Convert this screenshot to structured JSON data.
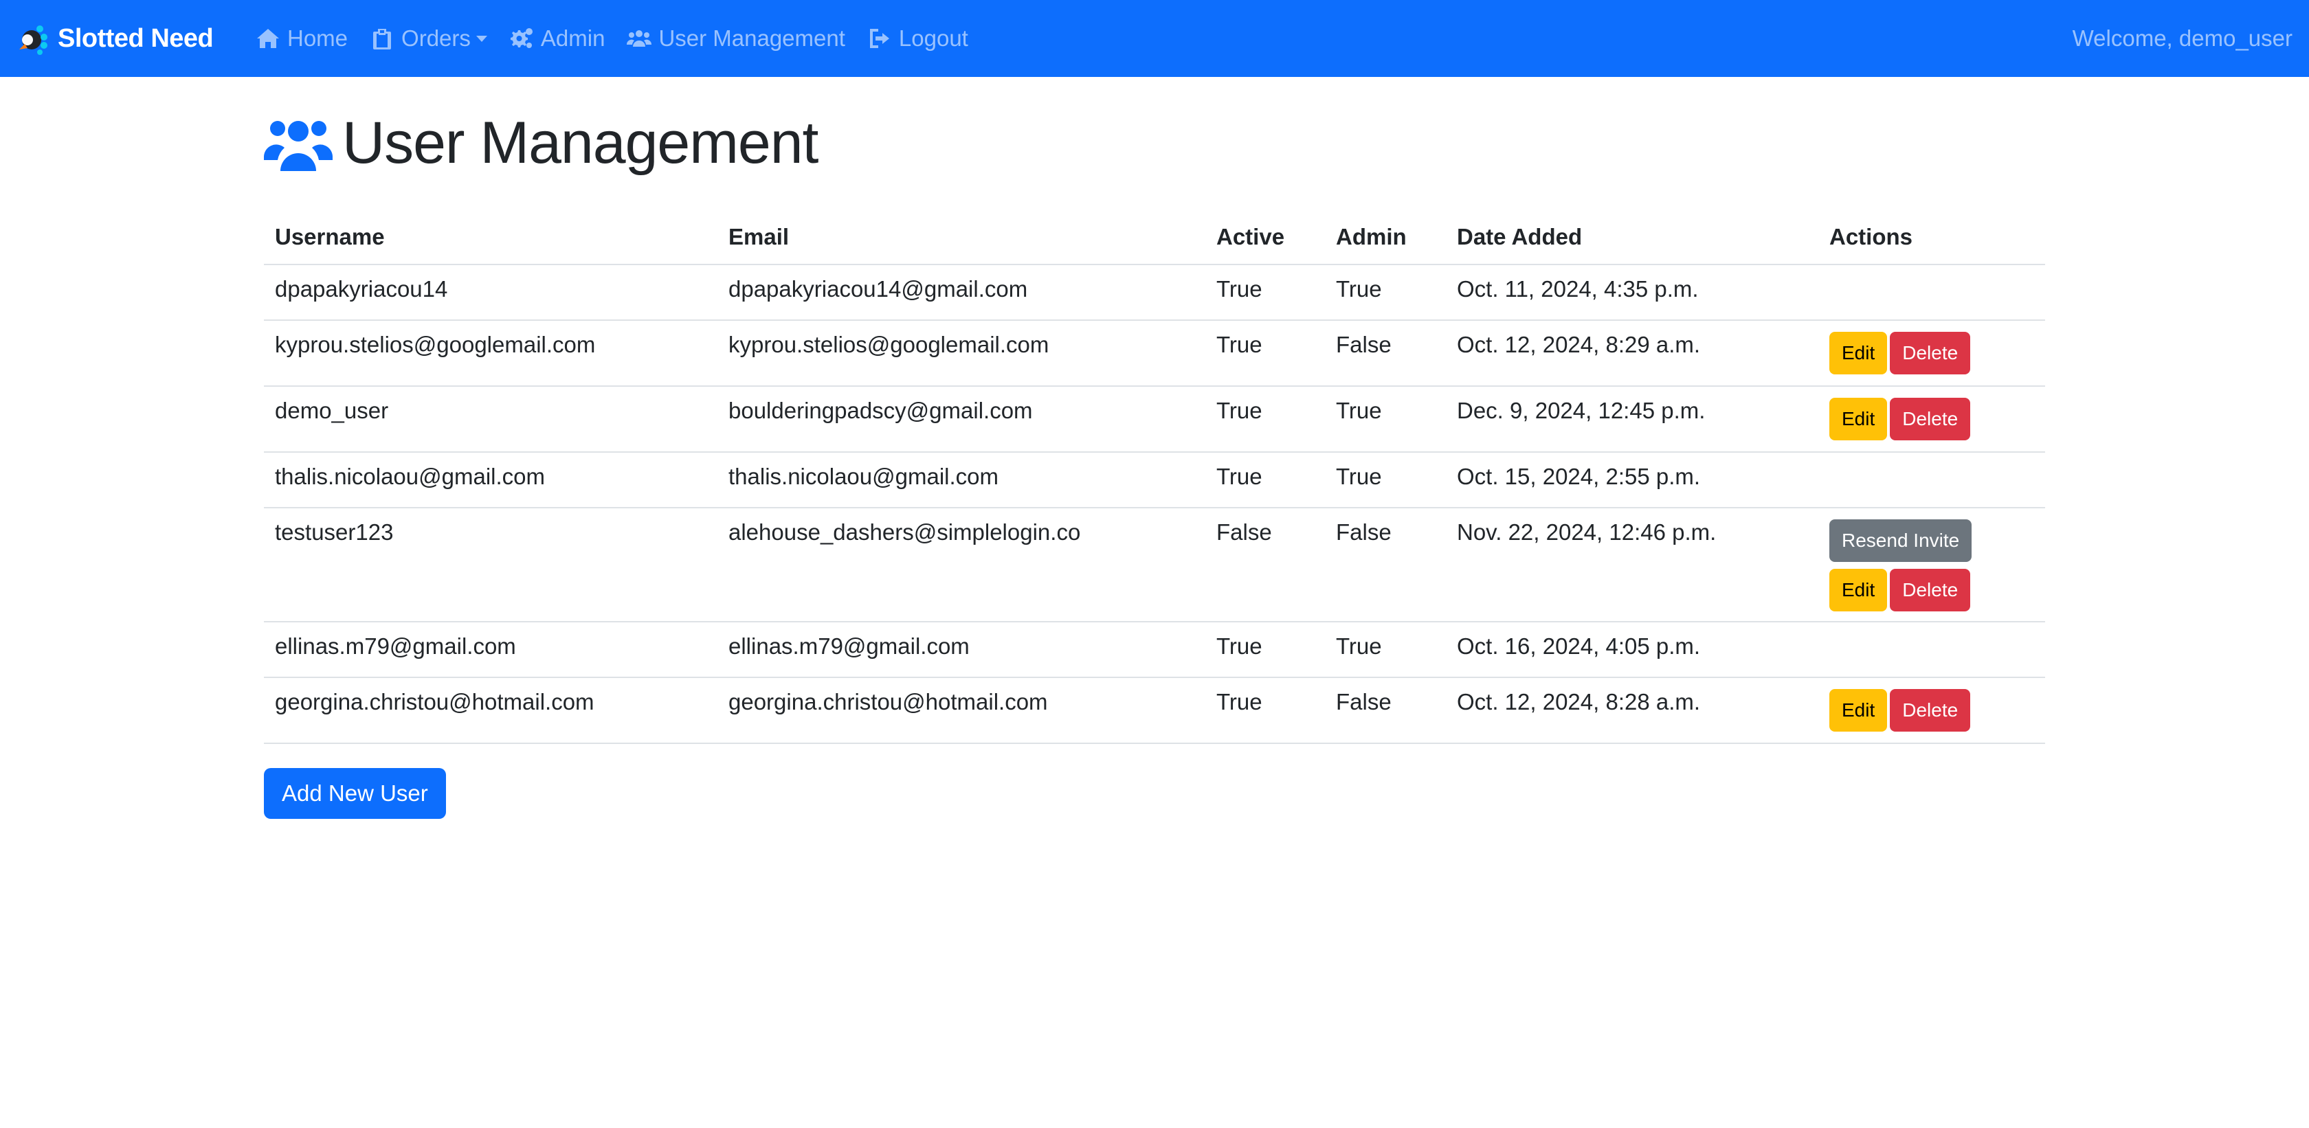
{
  "navbar": {
    "brand": "Slotted Need",
    "items": [
      {
        "label": "Home",
        "icon": "home-icon"
      },
      {
        "label": "Orders",
        "icon": "clipboard-icon",
        "dropdown": true
      },
      {
        "label": "Admin",
        "icon": "gears-icon"
      },
      {
        "label": "User Management",
        "icon": "users-icon"
      },
      {
        "label": "Logout",
        "icon": "logout-icon"
      }
    ],
    "welcome": "Welcome, demo_user"
  },
  "page": {
    "title": "User Management",
    "title_icon": "users-icon"
  },
  "table": {
    "headers": [
      "Username",
      "Email",
      "Active",
      "Admin",
      "Date Added",
      "Actions"
    ],
    "rows": [
      {
        "username": "dpapakyriacou14",
        "email": "dpapakyriacou14@gmail.com",
        "active": "True",
        "admin": "True",
        "date_added": "Oct. 11, 2024, 4:35 p.m.",
        "actions": []
      },
      {
        "username": "kyprou.stelios@googlemail.com",
        "email": "kyprou.stelios@googlemail.com",
        "active": "True",
        "admin": "False",
        "date_added": "Oct. 12, 2024, 8:29 a.m.",
        "actions": [
          "Edit",
          "Delete"
        ]
      },
      {
        "username": "demo_user",
        "email": "boulderingpadscy@gmail.com",
        "active": "True",
        "admin": "True",
        "date_added": "Dec. 9, 2024, 12:45 p.m.",
        "actions": [
          "Edit",
          "Delete"
        ]
      },
      {
        "username": "thalis.nicolaou@gmail.com",
        "email": "thalis.nicolaou@gmail.com",
        "active": "True",
        "admin": "True",
        "date_added": "Oct. 15, 2024, 2:55 p.m.",
        "actions": []
      },
      {
        "username": "testuser123",
        "email": "alehouse_dashers@simplelogin.co",
        "active": "False",
        "admin": "False",
        "date_added": "Nov. 22, 2024, 12:46 p.m.",
        "actions": [
          "Resend Invite",
          "Edit",
          "Delete"
        ]
      },
      {
        "username": "ellinas.m79@gmail.com",
        "email": "ellinas.m79@gmail.com",
        "active": "True",
        "admin": "True",
        "date_added": "Oct. 16, 2024, 4:05 p.m.",
        "actions": []
      },
      {
        "username": "georgina.christou@hotmail.com",
        "email": "georgina.christou@hotmail.com",
        "active": "True",
        "admin": "False",
        "date_added": "Oct. 12, 2024, 8:28 a.m.",
        "actions": [
          "Edit",
          "Delete"
        ]
      }
    ]
  },
  "add_button": "Add New User",
  "colors": {
    "primary": "#0d6efd",
    "warning": "#ffc107",
    "danger": "#dc3545",
    "secondary": "#6c757d"
  }
}
